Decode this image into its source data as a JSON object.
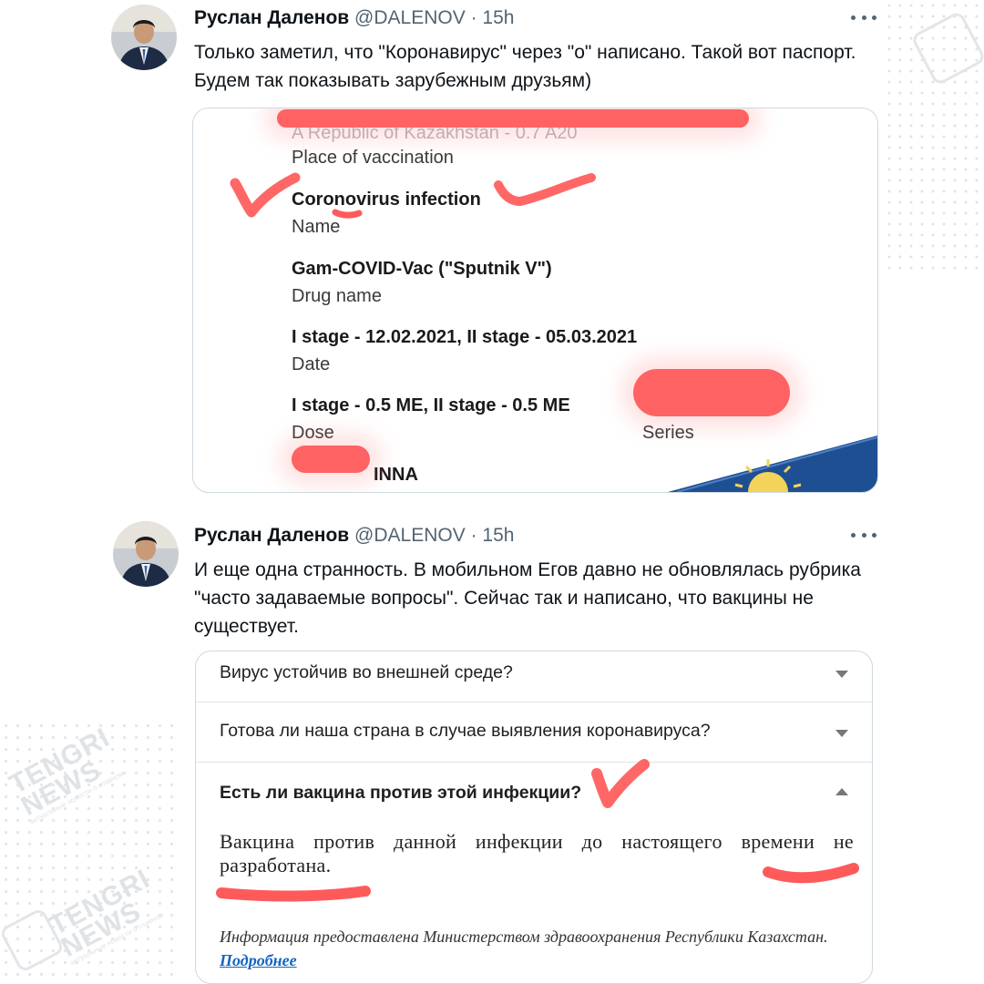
{
  "watermark": {
    "brand": "TENGRI",
    "sub": "NEWS",
    "tagline": "актуальные новости о главном"
  },
  "colors": {
    "accent_link": "#1565c0",
    "redaction": "#ff6262",
    "muted": "#536471"
  },
  "tweets": [
    {
      "author_name": "Руслан Даленов",
      "handle": "@DALENOV",
      "separator": "·",
      "time": "15h",
      "text": "Только заметил, что \"Коронавирус\" через \"о\" написано. Такой вот паспорт. Будем так показывать зарубежным друзьям)",
      "attachment": {
        "top_partial": "A                    Republic of Kazakhstan - 0.7 A20",
        "fields": [
          {
            "value": "",
            "label": "Place of vaccination"
          },
          {
            "value": "Coronovirus infection",
            "label": "Name"
          },
          {
            "value": "Gam-COVID-Vac (\"Sputnik V\")",
            "label": "Drug name"
          },
          {
            "value": "I stage - 12.02.2021, II stage - 05.03.2021",
            "label": "Date"
          },
          {
            "value": "I stage - 0.5 ME, II stage - 0.5 ME",
            "label": "Dose"
          }
        ],
        "series_label": "Series",
        "bottom_name": "INNA"
      }
    },
    {
      "author_name": "Руслан Даленов",
      "handle": "@DALENOV",
      "separator": "·",
      "time": "15h",
      "text": "И еще одна странность. В мобильном Егов давно не обновлялась рубрика \"часто задаваемые вопросы\". Сейчас так и написано, что вакцины не существует.",
      "attachment": {
        "faq": [
          {
            "question": "Вирус устойчив во внешней среде?"
          },
          {
            "question": "Готова ли наша страна в случае выявления коронавируса?"
          },
          {
            "question": "Есть ли вакцина против этой инфекции?"
          }
        ],
        "answer": "Вакцина против данной инфекции до настоящего времени не разработана.",
        "source_text": "Информация предоставлена Министерством здравоохранения Республики Казахстан.",
        "source_link": "Подробнее"
      }
    }
  ]
}
